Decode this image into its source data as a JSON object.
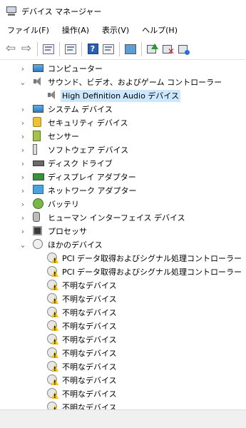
{
  "window": {
    "title": "デバイス マネージャー"
  },
  "menu": {
    "file": "ファイル(F)",
    "action": "操作(A)",
    "view": "表示(V)",
    "help": "ヘルプ(H)"
  },
  "toolbar": {
    "icons": [
      "back-arrow-icon",
      "forward-arrow-icon",
      "show-hide-console-tree-icon",
      "properties-icon",
      "help-icon",
      "action-pane-icon",
      "scan-hardware-changes-icon",
      "update-driver-icon",
      "uninstall-device-icon",
      "add-legacy-hardware-icon"
    ]
  },
  "tree": {
    "items": [
      {
        "label": "コンピューター",
        "level": 1,
        "expanded": false,
        "icon": "computer-icon"
      },
      {
        "label": "サウンド、ビデオ、およびゲーム コントローラー",
        "level": 1,
        "expanded": true,
        "icon": "speaker-icon"
      },
      {
        "label": "High Definition Audio デバイス",
        "level": 2,
        "selected": true,
        "icon": "speaker-icon"
      },
      {
        "label": "システム デバイス",
        "level": 1,
        "expanded": false,
        "icon": "system-device-icon"
      },
      {
        "label": "セキュリティ デバイス",
        "level": 1,
        "expanded": false,
        "icon": "security-key-icon"
      },
      {
        "label": "センサー",
        "level": 1,
        "expanded": false,
        "icon": "sensor-icon"
      },
      {
        "label": "ソフトウェア デバイス",
        "level": 1,
        "expanded": false,
        "icon": "software-device-icon"
      },
      {
        "label": "ディスク ドライブ",
        "level": 1,
        "expanded": false,
        "icon": "disk-drive-icon"
      },
      {
        "label": "ディスプレイ アダプター",
        "level": 1,
        "expanded": false,
        "icon": "display-adapter-icon"
      },
      {
        "label": "ネットワーク アダプター",
        "level": 1,
        "expanded": false,
        "icon": "network-adapter-icon"
      },
      {
        "label": "バッテリ",
        "level": 1,
        "expanded": false,
        "icon": "battery-icon"
      },
      {
        "label": "ヒューマン インターフェイス デバイス",
        "level": 1,
        "expanded": false,
        "icon": "hid-icon"
      },
      {
        "label": "プロセッサ",
        "level": 1,
        "expanded": false,
        "icon": "processor-icon"
      },
      {
        "label": "ほかのデバイス",
        "level": 1,
        "expanded": true,
        "icon": "other-devices-icon"
      },
      {
        "label": "PCI データ取得およびシグナル処理コントローラー",
        "level": 2,
        "icon": "unknown-device-warning-icon"
      },
      {
        "label": "PCI データ取得およびシグナル処理コントローラー",
        "level": 2,
        "icon": "unknown-device-warning-icon"
      },
      {
        "label": "不明なデバイス",
        "level": 2,
        "icon": "unknown-device-warning-icon"
      },
      {
        "label": "不明なデバイス",
        "level": 2,
        "icon": "unknown-device-warning-icon"
      },
      {
        "label": "不明なデバイス",
        "level": 2,
        "icon": "unknown-device-warning-icon"
      },
      {
        "label": "不明なデバイス",
        "level": 2,
        "icon": "unknown-device-warning-icon"
      },
      {
        "label": "不明なデバイス",
        "level": 2,
        "icon": "unknown-device-warning-icon"
      },
      {
        "label": "不明なデバイス",
        "level": 2,
        "icon": "unknown-device-warning-icon"
      },
      {
        "label": "不明なデバイス",
        "level": 2,
        "icon": "unknown-device-warning-icon"
      },
      {
        "label": "不明なデバイス",
        "level": 2,
        "icon": "unknown-device-warning-icon"
      },
      {
        "label": "不明なデバイス",
        "level": 2,
        "icon": "unknown-device-warning-icon"
      },
      {
        "label": "不明なデバイス",
        "level": 2,
        "icon": "unknown-device-warning-icon"
      },
      {
        "label": "不明なデバイス",
        "level": 2,
        "icon": "unknown-device-warning-icon"
      }
    ]
  },
  "colors": {
    "selection": "#cce8ff",
    "statusbar": "#f0f0f0"
  }
}
